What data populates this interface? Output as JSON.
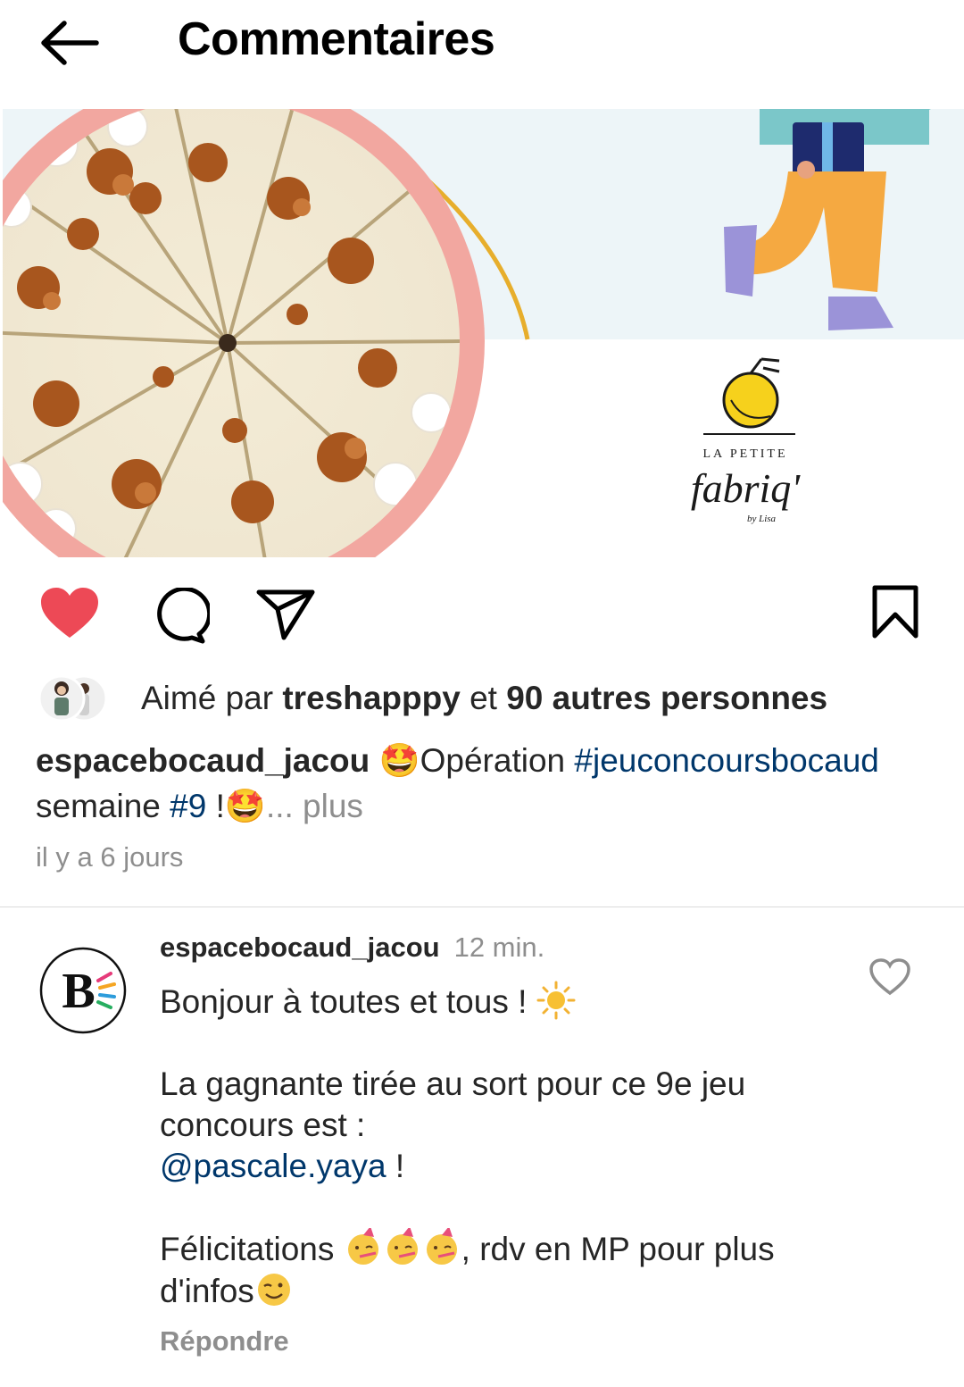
{
  "header": {
    "title": "Commentaires",
    "back_icon": "arrow-left-icon"
  },
  "post": {
    "image": {
      "logo_line1": "LA PETITE",
      "logo_line2": "fabriq'",
      "logo_line3": "by Lisa"
    },
    "actions": {
      "like_icon": "heart-filled-icon",
      "comment_icon": "comment-icon",
      "share_icon": "send-icon",
      "save_icon": "bookmark-icon",
      "like_color": "#ed4956"
    },
    "likes": {
      "prefix": "Aimé par",
      "liker": "treshapppy",
      "joiner": "et",
      "others": "90 autres personnes"
    },
    "caption": {
      "username": "espacebocaud_jacou",
      "emoji1": "🤩",
      "text1": "Opération",
      "hashtag1": "#jeuconcoursbocaud",
      "text2": "semaine",
      "hashtag2": "#9",
      "text3": "!",
      "emoji2": "🤩",
      "more": "... plus"
    },
    "timestamp": "il y a 6 jours"
  },
  "comment": {
    "avatar_letter": "B",
    "username": "espacebocaud_jacou",
    "time": "12 min.",
    "line1": "Bonjour à toutes et tous !",
    "line1_emoji": "☀️",
    "line2": "La gagnante tirée au sort pour ce 9e jeu concours est :",
    "mention": "@pascale.yaya",
    "mention_suffix": "!",
    "line3_start": "Félicitations",
    "party_emoji": "🥳",
    "line3_end": ", rdv en MP pour plus d'infos",
    "wink_emoji": "😉",
    "reply_label": "Répondre",
    "like_icon": "heart-outline-icon"
  }
}
